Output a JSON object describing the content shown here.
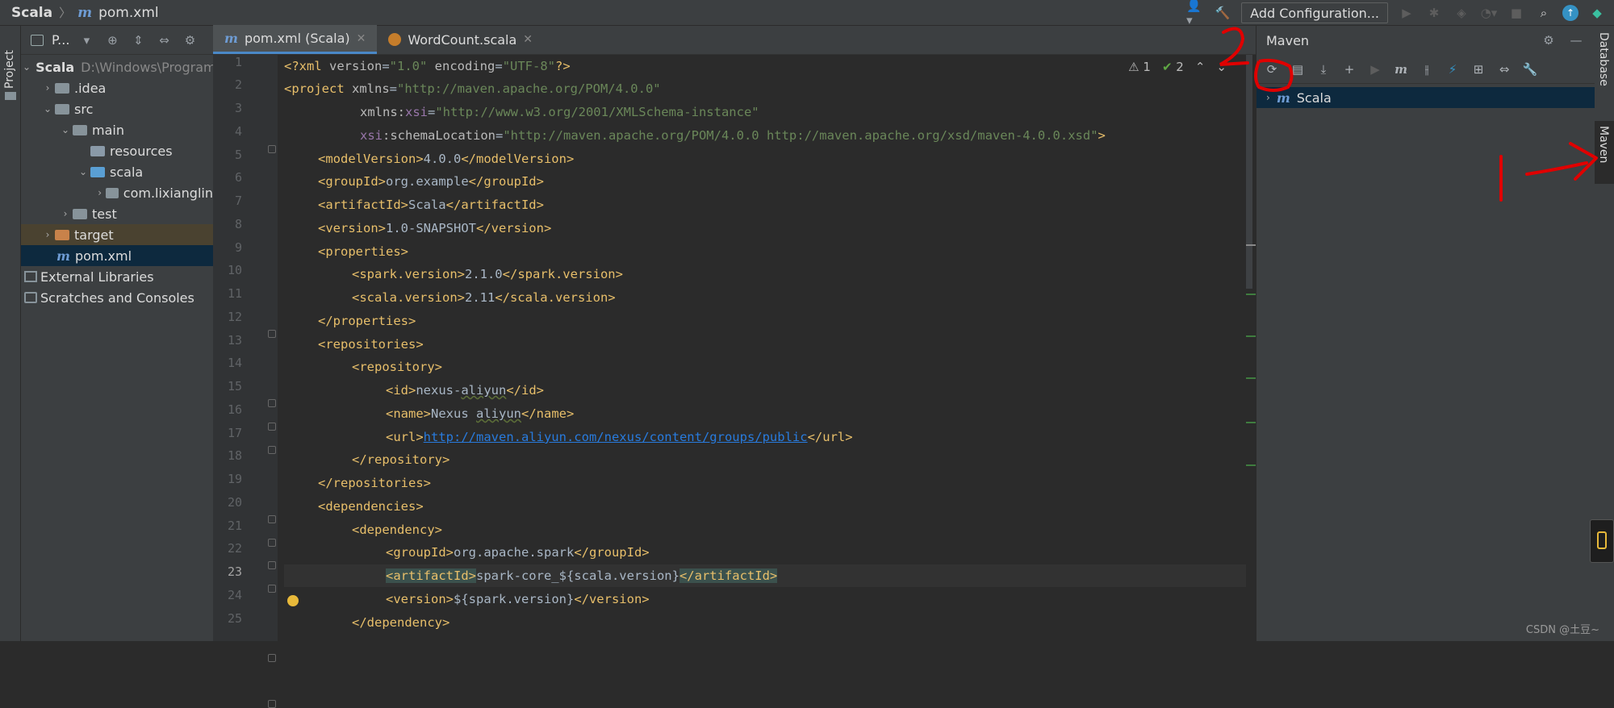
{
  "breadcrumb": {
    "project": "Scala",
    "file": "pom.xml"
  },
  "toolbar": {
    "add_config_label": "Add Configuration..."
  },
  "left_strip": {
    "project_label": "Project"
  },
  "project_panel": {
    "selector_label": "P...",
    "tree": [
      {
        "label": "Scala",
        "extra": "D:\\Windows\\Program"
      },
      {
        "label": ".idea"
      },
      {
        "label": "src"
      },
      {
        "label": "main"
      },
      {
        "label": "resources"
      },
      {
        "label": "scala"
      },
      {
        "label": "com.lixianglin"
      },
      {
        "label": "test"
      },
      {
        "label": "target"
      },
      {
        "label": "pom.xml"
      },
      {
        "label": "External Libraries"
      },
      {
        "label": "Scratches and Consoles"
      }
    ]
  },
  "tabs": [
    {
      "label": "pom.xml (Scala)",
      "icon": "maven-icon"
    },
    {
      "label": "WordCount.scala",
      "icon": "scala-object-icon"
    }
  ],
  "inspections": {
    "warnings": "1",
    "ok": "2"
  },
  "editor": {
    "current_line": 23,
    "line_numbers": [
      "1",
      "2",
      "3",
      "4",
      "5",
      "6",
      "7",
      "8",
      "9",
      "10",
      "11",
      "12",
      "13",
      "14",
      "15",
      "16",
      "17",
      "18",
      "19",
      "20",
      "21",
      "22",
      "23",
      "24",
      "25"
    ],
    "lines": {
      "l1a": "<?xml ",
      "l1b": "version",
      "l1c": "=",
      "l1d": "\"1.0\"",
      "l1e": " encoding",
      "l1f": "=",
      "l1g": "\"UTF-8\"",
      "l1h": "?>",
      "l2a": "<project ",
      "l2b": "xmlns",
      "l2c": "=",
      "l2d": "\"http://maven.apache.org/POM/4.0.0\"",
      "l3a": "xmlns:",
      "l3b": "xsi",
      "l3c": "=",
      "l3d": "\"http://www.w3.org/2001/XMLSchema-instance\"",
      "l4a": "xsi",
      "l4b": ":schemaLocation",
      "l4c": "=",
      "l4d": "\"http://maven.apache.org/POM/4.0.0 http://maven.apache.org/xsd/maven-4.0.0.xsd\"",
      "l4e": ">",
      "l5a": "<modelVersion>",
      "l5b": "4.0.0",
      "l5c": "</modelVersion>",
      "l6a": "<groupId>",
      "l6b": "org.example",
      "l6c": "</groupId>",
      "l7a": "<artifactId>",
      "l7b": "Scala",
      "l7c": "</artifactId>",
      "l8a": "<version>",
      "l8b": "1.0-SNAPSHOT",
      "l8c": "</version>",
      "l9": "<properties>",
      "l10a": "<spark.version>",
      "l10b": "2.1.0",
      "l10c": "</spark.version>",
      "l11a": "<scala.version>",
      "l11b": "2.11",
      "l11c": "</scala.version>",
      "l12": "</properties>",
      "l13": "<repositories>",
      "l14": "<repository>",
      "l15a": "<id>",
      "l15b": "nexus-",
      "l15c": "aliyun",
      "l15d": "</id>",
      "l16a": "<name>",
      "l16b": "Nexus ",
      "l16c": "aliyun",
      "l16d": "</name>",
      "l17a": "<url>",
      "l17b": "http://maven.aliyun.com/nexus/content/groups/public",
      "l17c": "</url>",
      "l18": "</repository>",
      "l19": "</repositories>",
      "l20": "<dependencies>",
      "l21": "<dependency>",
      "l22a": "<groupId>",
      "l22b": "org.apache.spark",
      "l22c": "</groupId>",
      "l23a": "<artifactId>",
      "l23b": "spark-core_${scala.version}",
      "l23c": "</artifactId>",
      "l24a": "<version>",
      "l24b": "${spark.version}",
      "l24c": "</version>",
      "l25": "</dependency>"
    }
  },
  "maven_panel": {
    "title": "Maven",
    "project_label": "Scala"
  },
  "right_strip": {
    "database_label": "Database",
    "maven_label": "Maven"
  },
  "watermark": "CSDN @土豆~",
  "colors": {
    "accent": "#4a88c7",
    "annotation": "#e00000"
  }
}
